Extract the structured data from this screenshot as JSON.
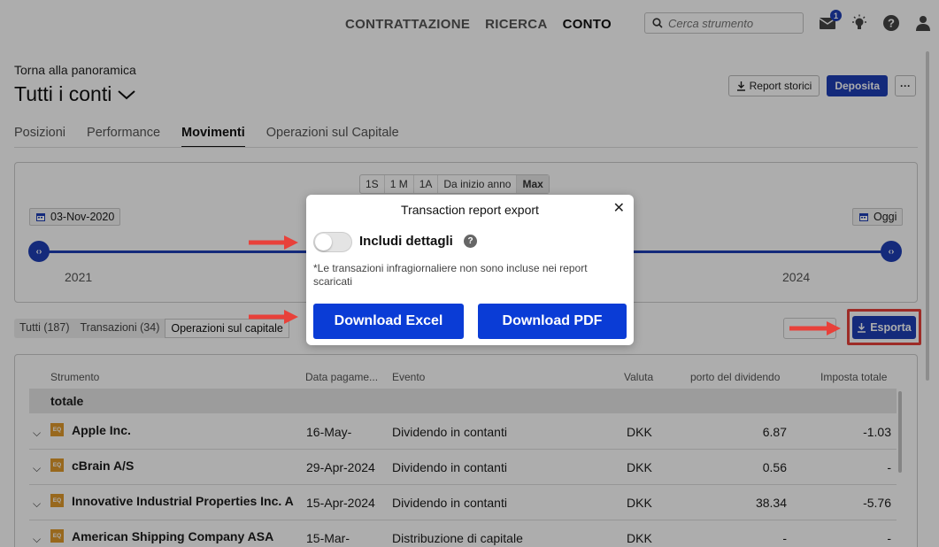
{
  "nav": {
    "links": [
      "CONTRATTAZIONE",
      "RICERCA",
      "CONTO"
    ],
    "search_placeholder": "Cerca strumento",
    "notification_count": "1"
  },
  "header": {
    "back_link": "Torna alla panoramica",
    "title": "Tutti i conti",
    "buttons": {
      "report": "Report storici",
      "deposit": "Deposita",
      "more": "···"
    }
  },
  "tabs": [
    "Posizioni",
    "Performance",
    "Movimenti",
    "Operazioni sul Capitale"
  ],
  "timeline": {
    "periods": [
      "1S",
      "1 M",
      "1A",
      "Da inizio anno",
      "Max"
    ],
    "start_date": "03-Nov-2020",
    "end_date": "Oggi",
    "years": [
      "2021",
      "2024"
    ]
  },
  "filters": {
    "tabs": [
      "Tutti (187)",
      "Transazioni (34)",
      "Operazioni sul capitale"
    ],
    "export": "Esporta"
  },
  "table": {
    "headers": [
      "Strumento",
      "Data pagame...",
      "Evento",
      "Valuta",
      "porto del dividendo",
      "Imposta totale"
    ],
    "total_label": "totale",
    "rows": [
      {
        "badge": "EQ",
        "name": "Apple Inc.",
        "date": "16-May-",
        "event": "Dividendo in contanti",
        "currency": "DKK",
        "amount": "6.87",
        "tax": "-1.03"
      },
      {
        "badge": "EQ",
        "name": "cBrain A/S",
        "date": "29-Apr-2024",
        "event": "Dividendo in contanti",
        "currency": "DKK",
        "amount": "0.56",
        "tax": "-"
      },
      {
        "badge": "EQ",
        "name": "Innovative Industrial Properties Inc. A",
        "date": "15-Apr-2024",
        "event": "Dividendo in contanti",
        "currency": "DKK",
        "amount": "38.34",
        "tax": "-5.76"
      },
      {
        "badge": "EQ",
        "name": "American Shipping Company ASA",
        "date": "15-Mar-",
        "event": "Distribuzione di capitale",
        "currency": "DKK",
        "amount": "-",
        "tax": "-"
      }
    ]
  },
  "modal": {
    "title": "Transaction report export",
    "toggle_label": "Includi dettagli",
    "toggle_on": false,
    "note": "*Le transazioni infragiornaliere non sono incluse nei report scaricati",
    "download_excel": "Download Excel",
    "download_pdf": "Download PDF"
  },
  "colors": {
    "accent": "#1e3fb5",
    "arrow": "#e8413a",
    "eq_badge": "#e09a2b"
  }
}
